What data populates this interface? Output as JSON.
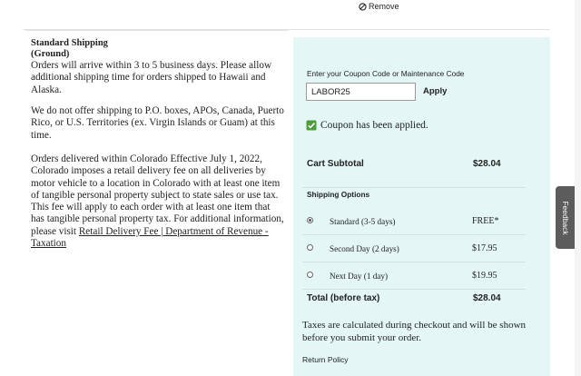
{
  "remove_label": "Remove",
  "shipping": {
    "title_line1": "Standard Shipping",
    "title_line2": "(Ground)",
    "para1": "Orders will arrive within 3 to 5 business days. Please allow additional shipping time for orders shipped to Hawaii and Alaska.",
    "para2": "We do not offer shipping to P.O. boxes, APOs, Canada, Puerto Rico, or U.S. Territories (ex. Virgin Islands or Guam) at this time.",
    "para3_text": "Orders delivered within Colorado Effective July 1, 2022, Colorado imposes a retail delivery fee on all deliveries by motor vehicle to a location in Colorado with at least one item of tangible personal property subject to state sales or use tax. This fee will apply to each order with at least one item that has tangible personal property tax. For additional information, please visit ",
    "para3_link": "Retail Delivery Fee | Department of Revenue - Taxation"
  },
  "coupon": {
    "label": "Enter your Coupon Code or Maintenance Code",
    "value": "LABOR25",
    "apply_label": "Apply",
    "applied_message": "Coupon has been applied."
  },
  "summary": {
    "subtotal_label": "Cart Subtotal",
    "subtotal_value": "$28.04",
    "shipping_options_label": "Shipping Options",
    "options": [
      {
        "label": "Standard (3-5 days)",
        "price": "FREE*",
        "selected": true
      },
      {
        "label": "Second Day (2 days)",
        "price": "$17.95",
        "selected": false
      },
      {
        "label": "Next Day (1 day)",
        "price": "$19.95",
        "selected": false
      }
    ],
    "total_label": "Total (before tax)",
    "total_value": "$28.04",
    "tax_note": "Taxes are calculated during checkout and will be shown before you submit your order.",
    "return_policy": "Return Policy"
  },
  "feedback_label": "Feedback",
  "colors": {
    "panel_bg": "#e4f6f6",
    "check_green": "#4f9d3a",
    "feedback_bg": "#5c5c5c"
  }
}
